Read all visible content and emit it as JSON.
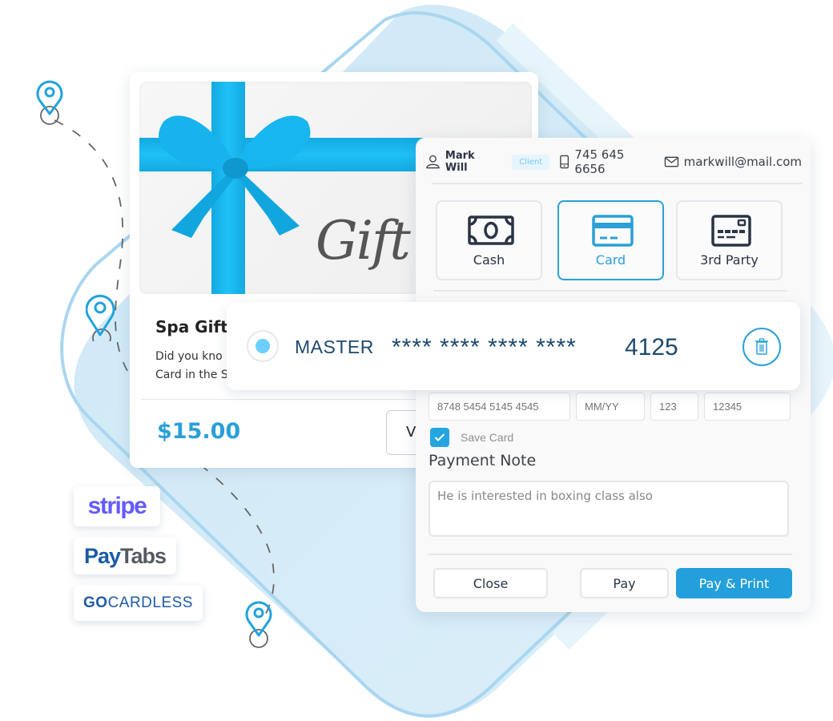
{
  "gift_card": {
    "image_script": "Gift C",
    "title": "Spa Gift",
    "description_line1": "Did you kno",
    "description_line2": "Card in the S",
    "price": "$15.00",
    "view_button_partial": "V"
  },
  "client": {
    "name": "Mark Will",
    "badge": "Client",
    "phone": "745 645 6656",
    "email": "markwill@mail.com"
  },
  "payment_methods": [
    {
      "label": "Cash",
      "icon": "cash-icon",
      "active": false
    },
    {
      "label": "Card",
      "icon": "credit-card-icon",
      "active": true
    },
    {
      "label": "3rd Party",
      "icon": "card-terminal-icon",
      "active": false
    }
  ],
  "saved_card": {
    "brand": "MASTER",
    "masked": "**** **** **** ****",
    "last4": "4125",
    "selected": true
  },
  "card_form": {
    "number_placeholder": "8748 5454 5145 4545",
    "expiry_placeholder": "MM/YY",
    "cvv_placeholder": "123",
    "zip_placeholder": "12345",
    "save_card_label": "Save Card",
    "save_card_checked": true
  },
  "payment_note": {
    "title": "Payment Note",
    "value": "He is interested in boxing class also"
  },
  "actions": {
    "close": "Close",
    "pay": "Pay",
    "pay_print": "Pay & Print"
  },
  "gateways": {
    "stripe": "stripe",
    "paytabs_pay": "Pay",
    "paytabs_tabs": "Tabs",
    "gocardless_go": "GO",
    "gocardless_rest": "CARDLESS"
  },
  "colors": {
    "accent": "#239fdb",
    "ribbon": "#1fc1f7",
    "background_shape": "#d3ebf7",
    "stripe": "#635bff",
    "card_text": "#1c4a6e"
  }
}
